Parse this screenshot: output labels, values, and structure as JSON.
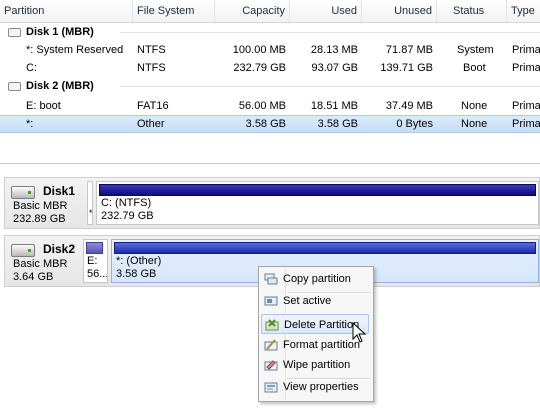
{
  "table": {
    "columns": [
      "Partition",
      "File System",
      "Capacity",
      "Used",
      "Unused",
      "Status",
      "Type"
    ],
    "groups": [
      {
        "label": "Disk 1 (MBR)",
        "rows": [
          {
            "partition": "*: System Reserved",
            "fs": "NTFS",
            "capacity": "100.00 MB",
            "used": "28.13 MB",
            "unused": "71.87 MB",
            "status": "System",
            "type": "Primary",
            "selected": false
          },
          {
            "partition": "C:",
            "fs": "NTFS",
            "capacity": "232.79 GB",
            "used": "93.07 GB",
            "unused": "139.71 GB",
            "status": "Boot",
            "type": "Primary",
            "selected": false
          }
        ]
      },
      {
        "label": "Disk 2 (MBR)",
        "rows": [
          {
            "partition": "E: boot",
            "fs": "FAT16",
            "capacity": "56.00 MB",
            "used": "18.51 MB",
            "unused": "37.49 MB",
            "status": "None",
            "type": "Primary",
            "selected": false
          },
          {
            "partition": "*:",
            "fs": "Other",
            "capacity": "3.58 GB",
            "used": "3.58 GB",
            "unused": "0 Bytes",
            "status": "None",
            "type": "Primary",
            "selected": true
          }
        ]
      }
    ]
  },
  "disks": [
    {
      "name": "Disk1",
      "type": "Basic MBR",
      "size": "232.89 GB",
      "small_part_label": "*",
      "main_part": {
        "name": "C: (NTFS)",
        "size": "232.79 GB"
      }
    },
    {
      "name": "Disk2",
      "type": "Basic MBR",
      "size": "3.64 GB",
      "small_part": {
        "name": "E:",
        "size": "56..."
      },
      "main_part": {
        "name": "*: (Other)",
        "size": "3.58 GB"
      }
    }
  ],
  "context_menu": {
    "items": [
      {
        "label": "Copy partition",
        "icon": "copy-partition-icon"
      },
      {
        "label": "Set active",
        "icon": "set-active-icon"
      },
      {
        "label": "Delete Partition",
        "icon": "delete-partition-icon",
        "hover": true
      },
      {
        "label": "Format partition",
        "icon": "format-partition-icon"
      },
      {
        "label": "Wipe partition",
        "icon": "wipe-partition-icon"
      },
      {
        "label": "View properties",
        "icon": "view-properties-icon"
      }
    ]
  },
  "colors": {
    "selection": "#c5ddf8",
    "partition_bar": "#0c0c80",
    "menu_background": "#f6f6f6"
  }
}
